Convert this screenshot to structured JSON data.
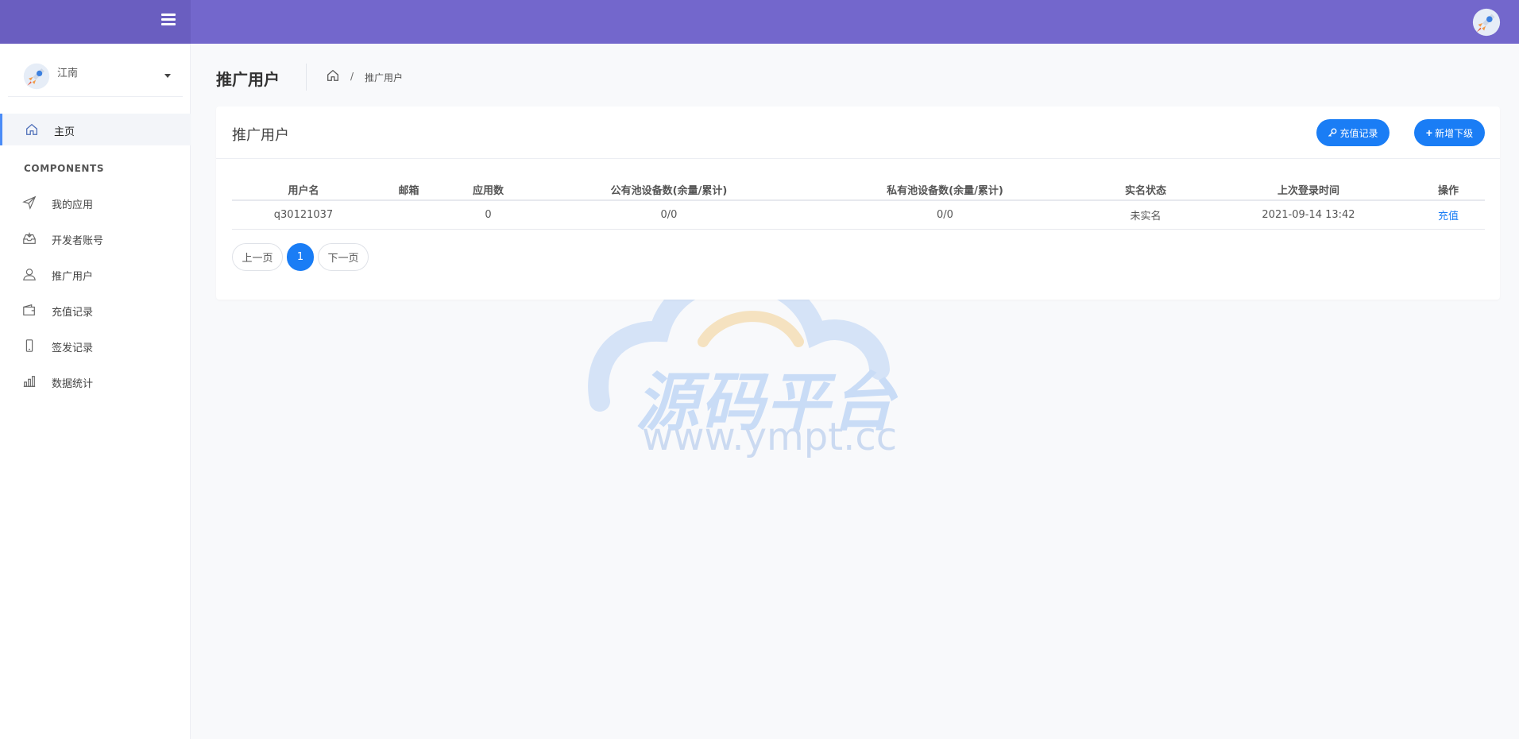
{
  "user": {
    "name": "江南"
  },
  "sidebar": {
    "items": [
      {
        "label": "主页"
      },
      {
        "label": "我的应用"
      },
      {
        "label": "开发者账号"
      },
      {
        "label": "推广用户"
      },
      {
        "label": "充值记录"
      },
      {
        "label": "签发记录"
      },
      {
        "label": "数据统计"
      }
    ],
    "section_title": "COMPONENTS"
  },
  "page": {
    "title": "推广用户",
    "breadcrumb_sep": "/",
    "breadcrumb_current": "推广用户"
  },
  "card": {
    "title": "推广用户",
    "btn_record": "充值记录",
    "btn_add": "新增下级"
  },
  "table": {
    "headers": [
      "用户名",
      "邮箱",
      "应用数",
      "公有池设备数(余量/累计)",
      "私有池设备数(余量/累计)",
      "实名状态",
      "上次登录时间",
      "操作"
    ],
    "rows": [
      [
        "q30121037",
        "",
        "0",
        "0/0",
        "0/0",
        "未实名",
        "2021-09-14 13:42",
        "充值"
      ]
    ]
  },
  "pager": {
    "prev": "上一页",
    "current": "1",
    "next": "下一页"
  },
  "watermark": {
    "text": "源码平台",
    "url": "www.ympt.cc"
  },
  "colors": {
    "topbar": "#7367cc",
    "accent": "#1a7df5"
  }
}
